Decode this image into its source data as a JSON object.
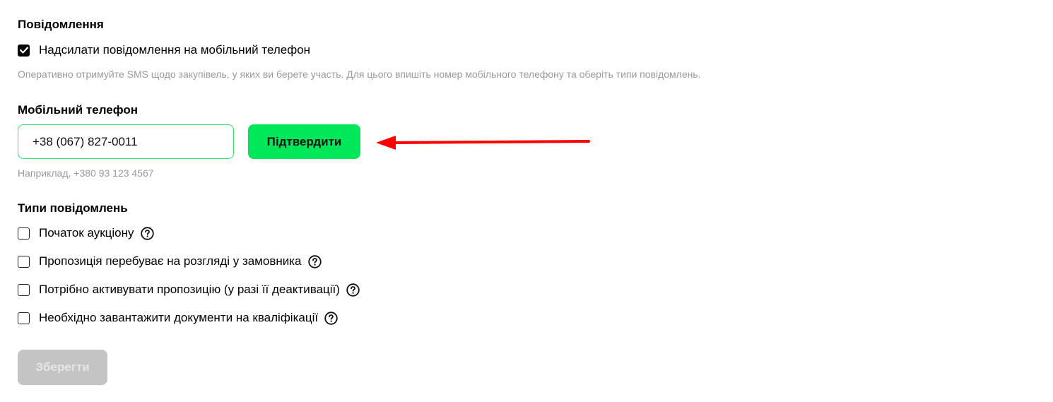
{
  "notifications": {
    "title": "Повідомлення",
    "sms_checkbox": {
      "label": "Надсилати повідомлення на мобільний телефон",
      "checked": true
    },
    "description": "Оперативно отримуйте SMS щодо закупівель, у яких ви берете участь. Для цього впишіть номер мобільного телефону та оберіть типи повідомлень."
  },
  "phone": {
    "title": "Мобільний телефон",
    "value": "+38 (067) 827-0011",
    "confirm_label": "Підтвердити",
    "hint": "Наприклад, +380 93 123 4567"
  },
  "annotation": {
    "arrow_color": "#ff0000",
    "icon": "arrow-left-icon"
  },
  "types": {
    "title": "Типи повідомлень",
    "items": [
      {
        "label": "Початок аукціону",
        "checked": false
      },
      {
        "label": "Пропозиція перебуває на розгляді у замовника",
        "checked": false
      },
      {
        "label": "Потрібно активувати пропозицію (у разі її деактивації)",
        "checked": false
      },
      {
        "label": "Необхідно завантажити документи на кваліфікації",
        "checked": false
      }
    ]
  },
  "save_label": "Зберегти",
  "colors": {
    "accent": "#00e859",
    "input_border": "#2ee56b",
    "disabled": "#c4c4c4",
    "hint": "#9a9a9a"
  }
}
